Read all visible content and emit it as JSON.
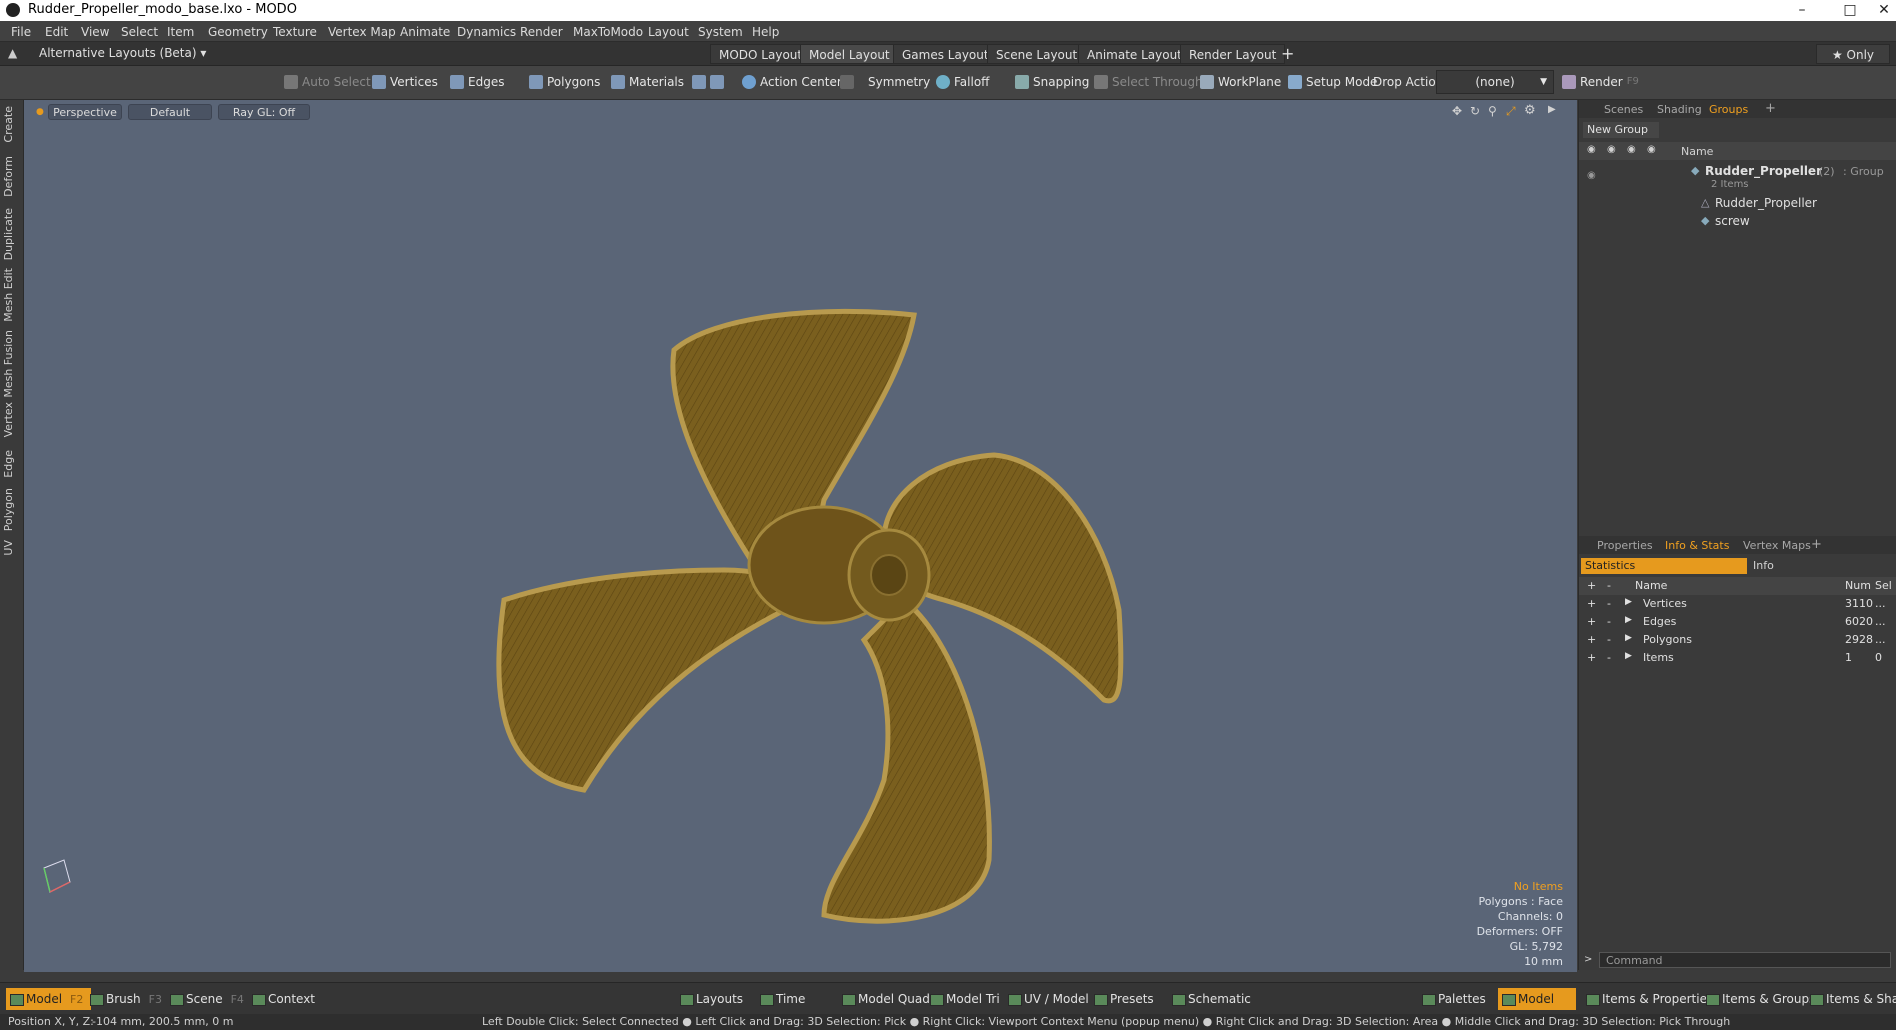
{
  "window": {
    "title": "Rudder_Propeller_modo_base.lxo - MODO",
    "min": "–",
    "max": "□",
    "close": "✕"
  },
  "menu": [
    "File",
    "Edit",
    "View",
    "Select",
    "Item",
    "Geometry",
    "Texture",
    "Vertex Map",
    "Animate",
    "Dynamics",
    "Render",
    "MaxToModo",
    "Layout",
    "System",
    "Help"
  ],
  "layouts": {
    "alt": "Alternative Layouts (Beta) ▾",
    "tabs": [
      "MODO Layout",
      "Model Layout",
      "Games Layout",
      "Scene Layout",
      "Animate Layout",
      "Render Layout"
    ],
    "plus": "+",
    "only": "★  Only"
  },
  "toolbar": {
    "auto_select": "Auto Select",
    "vertices": "Vertices",
    "edges": "Edges",
    "polygons": "Polygons",
    "materials": "Materials",
    "action_center": "Action Center",
    "symmetry": "Symmetry",
    "falloff": "Falloff",
    "snapping": "Snapping",
    "select_through": "Select Through",
    "workplane": "WorkPlane",
    "setup_mode": "Setup Mode",
    "drop_action": "Drop Action",
    "drop_value": "(none)",
    "render": "Render",
    "render_key": "F9"
  },
  "lefttabs": [
    "Create",
    "Deform",
    "Duplicate",
    "Mesh Edit",
    "Mesh Fusion",
    "Vertex",
    "Edge",
    "Polygon",
    "UV"
  ],
  "viewport": {
    "perspective": "Perspective",
    "default": "Default",
    "raygl": "Ray GL: Off",
    "info": {
      "items": "No Items",
      "polygons": "Polygons : Face",
      "channels": "Channels: 0",
      "deformers": "Deformers: OFF",
      "gl": "GL: 5,792",
      "scale": "10 mm"
    }
  },
  "scenes": {
    "tabs": [
      "Scenes",
      "Shading",
      "Groups"
    ],
    "plus": "+",
    "new_group": "New Group",
    "col_name": "Name",
    "group_name": "Rudder_Propeller",
    "group_count": "(2)",
    "group_type": ": Group",
    "group_items": "2 Items",
    "children": [
      "Rudder_Propeller",
      "screw"
    ]
  },
  "props": {
    "tabs": [
      "Properties",
      "Info & Stats",
      "Vertex Maps"
    ],
    "plus": "+",
    "statistics": "Statistics",
    "info": "Info",
    "col_name": "Name",
    "col_num": "Num",
    "col_sel": "Sel",
    "rows": [
      {
        "name": "Vertices",
        "num": "3110",
        "sel": "..."
      },
      {
        "name": "Edges",
        "num": "6020",
        "sel": "..."
      },
      {
        "name": "Polygons",
        "num": "2928",
        "sel": "..."
      },
      {
        "name": "Items",
        "num": "1",
        "sel": "0"
      }
    ],
    "command": "Command"
  },
  "bottom": {
    "model": "Model",
    "model_key": "F2",
    "brush": "Brush",
    "brush_key": "F3",
    "scene": "Scene",
    "scene_key": "F4",
    "context": "Context",
    "layouts": "Layouts",
    "time": "Time",
    "quad": "Model Quad",
    "tri": "Model Tri",
    "uv": "UV / Model",
    "presets": "Presets",
    "schematic": "Schematic",
    "palettes": "Palettes",
    "model2": "Model",
    "ip": "Items & Properties",
    "ig": "Items & Groups",
    "is": "Items & Shadi"
  },
  "status": {
    "pos_label": "Position X, Y, Z:",
    "pos_value": "-104 mm, 200.5 mm, 0 m",
    "hint": "Left Double Click: Select Connected ●  Left Click and Drag: 3D Selection: Pick ●  Right Click: Viewport Context Menu (popup menu) ●  Right Click and Drag: 3D Selection: Area ●  Middle Click and Drag: 3D Selection: Pick Through"
  },
  "colors": {
    "viewport_bg": "#5a6577",
    "accent": "#e69a1e",
    "propeller": "#7a5f1e"
  }
}
